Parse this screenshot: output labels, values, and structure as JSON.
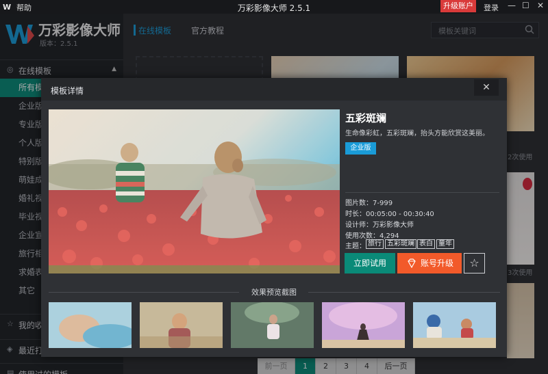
{
  "titlebar": {
    "logo_mark": "W",
    "help": "帮助",
    "title": "万彩影像大师 2.5.1",
    "upgrade": "升级账户",
    "login": "登录",
    "minimize": "—",
    "maximize": "☐",
    "close": "✕"
  },
  "sidebar": {
    "brand": "万彩影像大师",
    "version": "版本：2.5.1",
    "online_templates": "在线模板",
    "items": [
      {
        "label": "所有模板"
      },
      {
        "label": "企业版"
      },
      {
        "label": "专业版"
      },
      {
        "label": "个人版"
      },
      {
        "label": "特别版"
      },
      {
        "label": "萌娃成长"
      },
      {
        "label": "婚礼视频"
      },
      {
        "label": "毕业视频"
      },
      {
        "label": "企业宣传"
      },
      {
        "label": "旅行相册"
      },
      {
        "label": "求婚表白"
      },
      {
        "label": "其它"
      }
    ],
    "my_favorites": "我的收藏",
    "recent": "最近打开",
    "used_templates": "使用过的模板"
  },
  "topnav": {
    "tab_online": "在线模板",
    "tab_tutorial": "官方教程",
    "search_placeholder": "模板关键词"
  },
  "background": {
    "usage_1": "2次使用",
    "usage_2": "3次使用"
  },
  "pagination": {
    "prev": "前一页",
    "pages": [
      "1",
      "2",
      "3",
      "4"
    ],
    "next": "后一页"
  },
  "modal": {
    "title": "模板详情",
    "close": "✕",
    "template_name": "五彩斑斓",
    "description": "生命像彩虹，五彩斑斓，抬头方能欣赏这美丽。",
    "edition_badge": "企业版",
    "image_count": "图片数：7-999",
    "duration": "时长：00:05:00 - 00:30:40",
    "designer": "设计师：万彩影像大师",
    "usage_count": "使用次数：4,294",
    "theme_label": "主题：",
    "tags": [
      "旅行",
      "五彩斑斓",
      "表白",
      "童年"
    ],
    "try_button": "立即试用",
    "upgrade_button": "账号升级",
    "favorite_icon": "☆",
    "screenshots_label": "效果预览截图"
  },
  "colors": {
    "accent_teal": "#0a8a78",
    "accent_blue": "#1a9bd7",
    "accent_orange": "#f25a2a",
    "accent_red": "#d93a3a"
  }
}
